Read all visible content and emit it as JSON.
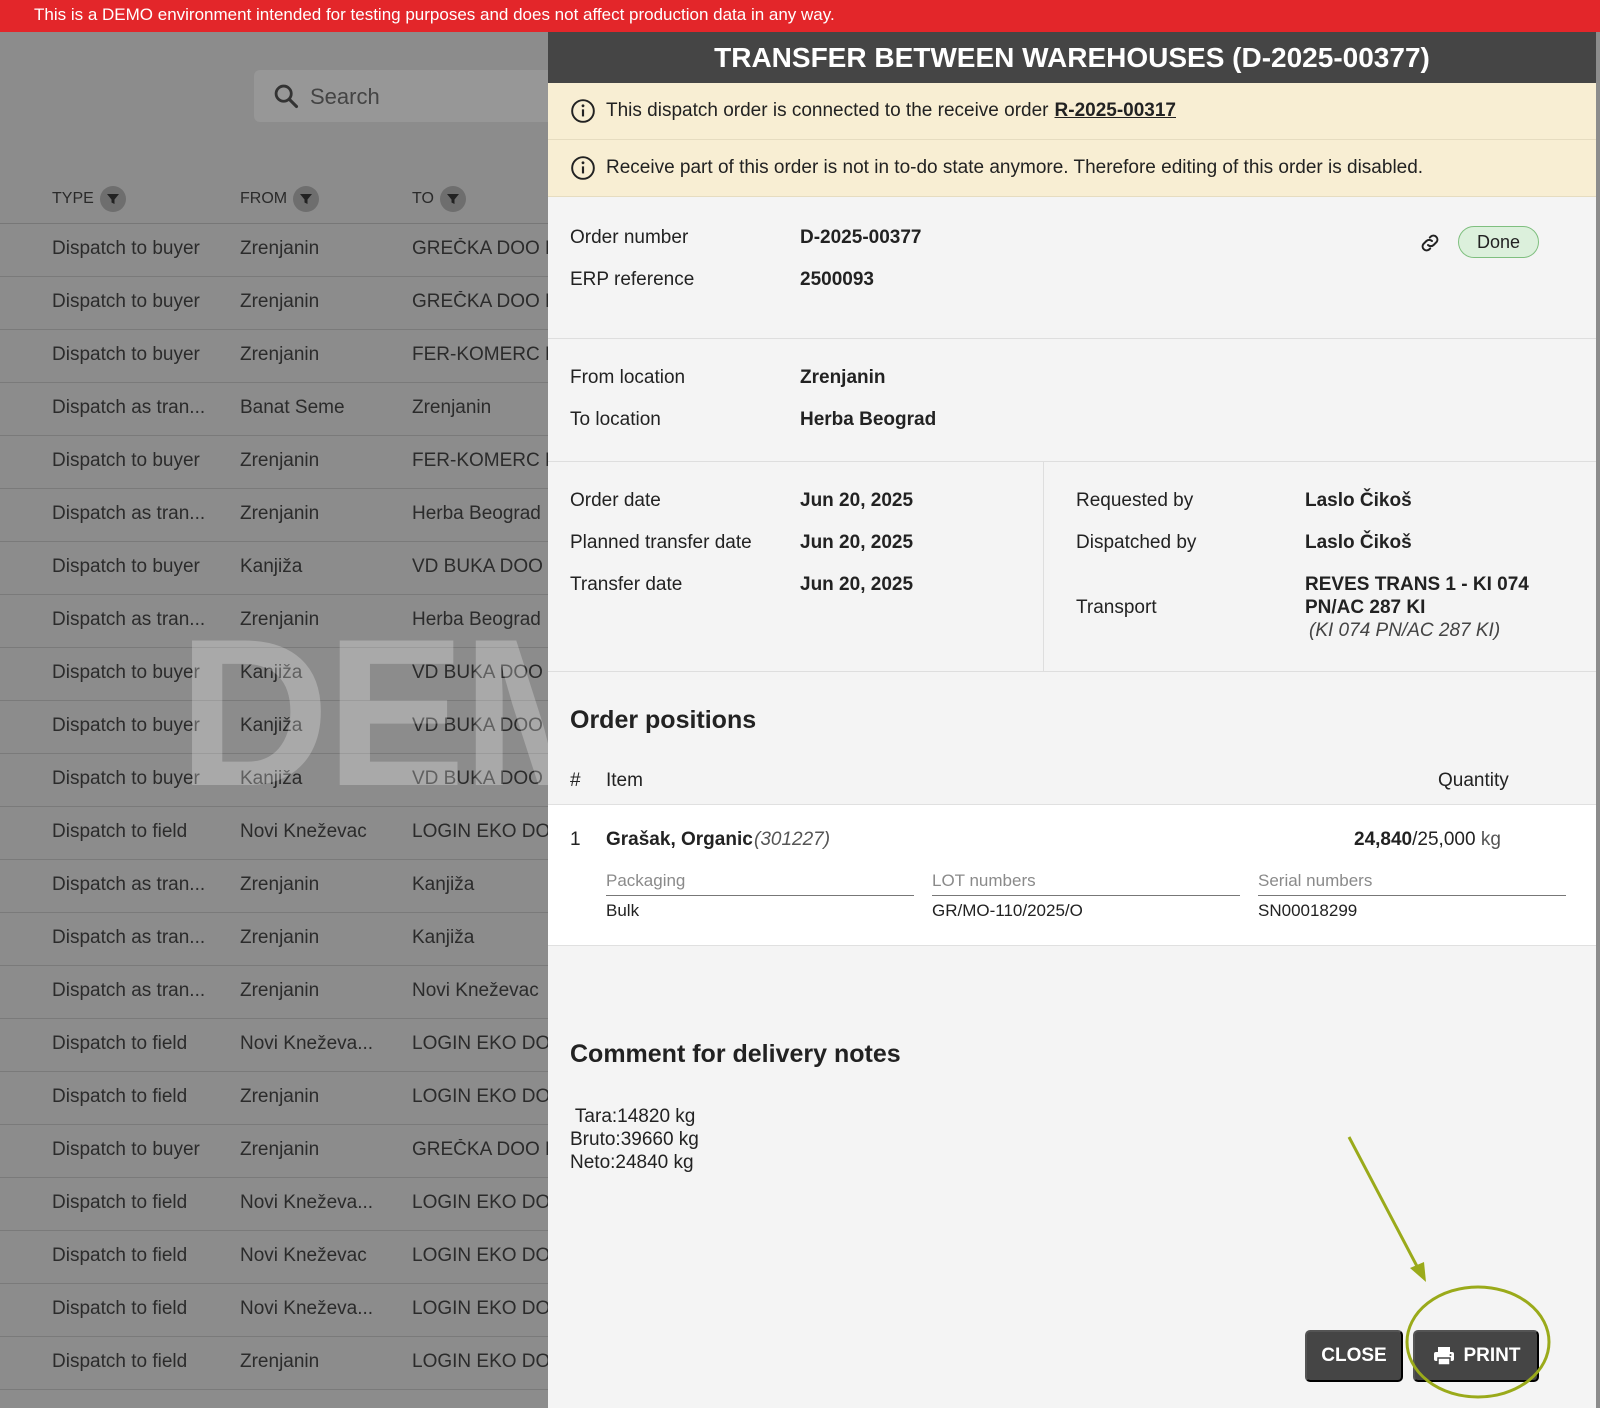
{
  "banner": {
    "text": "This is a DEMO environment intended for testing purposes and does not affect production data in any way."
  },
  "background_list": {
    "search_placeholder": "Search",
    "columns": {
      "type": "TYPE",
      "from": "FROM",
      "to": "TO"
    },
    "rows": [
      {
        "type": "Dispatch to buyer",
        "from": "Zrenjanin",
        "to": "GREČKA DOO E"
      },
      {
        "type": "Dispatch to buyer",
        "from": "Zrenjanin",
        "to": "GREČKA DOO E"
      },
      {
        "type": "Dispatch to buyer",
        "from": "Zrenjanin",
        "to": "FER-KOMERC D"
      },
      {
        "type": "Dispatch as tran...",
        "from": "Banat Seme",
        "to": "Zrenjanin"
      },
      {
        "type": "Dispatch to buyer",
        "from": "Zrenjanin",
        "to": "FER-KOMERC D"
      },
      {
        "type": "Dispatch as tran...",
        "from": "Zrenjanin",
        "to": "Herba Beograd"
      },
      {
        "type": "Dispatch to buyer",
        "from": "Kanjiža",
        "to": "VD BUKA DOO"
      },
      {
        "type": "Dispatch as tran...",
        "from": "Zrenjanin",
        "to": "Herba Beograd"
      },
      {
        "type": "Dispatch to buyer",
        "from": "Kanjiža",
        "to": "VD BUKA DOO"
      },
      {
        "type": "Dispatch to buyer",
        "from": "Kanjiža",
        "to": "VD BUKA DOO"
      },
      {
        "type": "Dispatch to buyer",
        "from": "Kanjiža",
        "to": "VD BUKA DOO"
      },
      {
        "type": "Dispatch to field",
        "from": "Novi Kneževac",
        "to": "LOGIN EKO DO"
      },
      {
        "type": "Dispatch as tran...",
        "from": "Zrenjanin",
        "to": "Kanjiža"
      },
      {
        "type": "Dispatch as tran...",
        "from": "Zrenjanin",
        "to": "Kanjiža"
      },
      {
        "type": "Dispatch as tran...",
        "from": "Zrenjanin",
        "to": "Novi Kneževac"
      },
      {
        "type": "Dispatch to field",
        "from": "Novi Kneževa...",
        "to": "LOGIN EKO DO"
      },
      {
        "type": "Dispatch to field",
        "from": "Zrenjanin",
        "to": "LOGIN EKO DO"
      },
      {
        "type": "Dispatch to buyer",
        "from": "Zrenjanin",
        "to": "GREČKA DOO E"
      },
      {
        "type": "Dispatch to field",
        "from": "Novi Kneževa...",
        "to": "LOGIN EKO DO"
      },
      {
        "type": "Dispatch to field",
        "from": "Novi Kneževac",
        "to": "LOGIN EKO DO"
      },
      {
        "type": "Dispatch to field",
        "from": "Novi Kneževa...",
        "to": "LOGIN EKO DO"
      },
      {
        "type": "Dispatch to field",
        "from": "Zrenjanin",
        "to": "LOGIN EKO DO"
      }
    ],
    "watermark": "DEMO"
  },
  "modal": {
    "title": "TRANSFER BETWEEN WAREHOUSES (D-2025-00377)",
    "notice_connected": {
      "text": "This dispatch order is connected to the receive order",
      "link": "R-2025-00317"
    },
    "notice_disabled": "Receive part of this order is not in to-do state anymore. Therefore editing of this order is disabled.",
    "order_number_label": "Order number",
    "order_number": "D-2025-00377",
    "erp_reference_label": "ERP reference",
    "erp_reference": "2500093",
    "status": "Done",
    "from_location_label": "From location",
    "from_location": "Zrenjanin",
    "to_location_label": "To location",
    "to_location": "Herba Beograd",
    "order_date_label": "Order date",
    "order_date": "Jun 20, 2025",
    "planned_transfer_date_label": "Planned transfer date",
    "planned_transfer_date": "Jun 20, 2025",
    "transfer_date_label": "Transfer date",
    "transfer_date": "Jun 20, 2025",
    "requested_by_label": "Requested by",
    "requested_by": "Laslo Čikoš",
    "dispatched_by_label": "Dispatched by",
    "dispatched_by": "Laslo Čikoš",
    "transport_label": "Transport",
    "transport_line1": "REVES TRANS 1 - KI 074",
    "transport_line2": "PN/AC 287 KI",
    "transport_note": "(KI 074 PN/AC 287 KI)",
    "order_positions_title": "Order positions",
    "positions_header": {
      "num": "#",
      "item": "Item",
      "quantity": "Quantity"
    },
    "position": {
      "num": "1",
      "item_name": "Grašak, Organic",
      "item_code": "(301227)",
      "qty_done": "24,840",
      "qty_total": "/25,000",
      "unit": "kg",
      "packaging_label": "Packaging",
      "packaging": "Bulk",
      "lot_label": "LOT numbers",
      "lot": "GR/MO-110/2025/O",
      "serial_label": "Serial numbers",
      "serial": "SN00018299"
    },
    "comment_title": "Comment for delivery notes",
    "comment_text": " Tara:14820 kg\nBruto:39660 kg\nNeto:24840 kg",
    "close_label": "CLOSE",
    "print_label": "PRINT"
  },
  "colors": {
    "banner": "#e3262a",
    "title_bar": "#454545",
    "notice_bg": "#f8eed3",
    "status_bg": "#dcf0dc",
    "annotation": "#9aaa1a"
  },
  "icons": [
    "search-icon",
    "filter-icon",
    "info-icon",
    "link-icon",
    "printer-icon"
  ]
}
